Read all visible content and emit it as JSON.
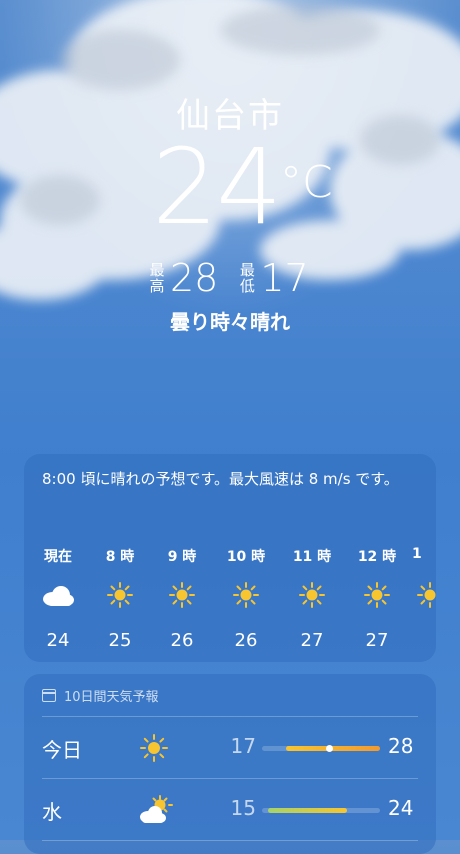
{
  "location": {
    "city": "仙台市",
    "temperature": "24",
    "unit": "°C",
    "high_label_1": "最",
    "high_label_2": "高",
    "high": "28",
    "low_label_1": "最",
    "low_label_2": "低",
    "low": "17",
    "condition": "曇り時々晴れ"
  },
  "hourly": {
    "summary": "8:00 頃に晴れの予想です。最大風速は 8 m/s です。",
    "items": [
      {
        "label": "現在",
        "icon": "cloud-icon",
        "temp": "24"
      },
      {
        "label": "8 時",
        "icon": "sun-icon",
        "temp": "25"
      },
      {
        "label": "9 時",
        "icon": "sun-icon",
        "temp": "26"
      },
      {
        "label": "10 時",
        "icon": "sun-icon",
        "temp": "26"
      },
      {
        "label": "11 時",
        "icon": "sun-icon",
        "temp": "27"
      },
      {
        "label": "12 時",
        "icon": "sun-icon",
        "temp": "27"
      },
      {
        "label": "1",
        "icon": "sun-icon",
        "temp": ""
      }
    ]
  },
  "forecast": {
    "title": "10日間天気予報",
    "days": [
      {
        "day": "今日",
        "icon": "sun-icon",
        "low": "17",
        "high": "28",
        "range_start": 0.2,
        "range_end": 1.0,
        "current_pos": 0.57
      },
      {
        "day": "水",
        "icon": "partly-sunny-icon",
        "low": "15",
        "high": "24",
        "range_start": 0.05,
        "range_end": 0.72
      }
    ]
  },
  "colors": {
    "sun": "#f7c530",
    "bar_warm": "#f29a2f",
    "bar_mild": "#a6d36b"
  }
}
